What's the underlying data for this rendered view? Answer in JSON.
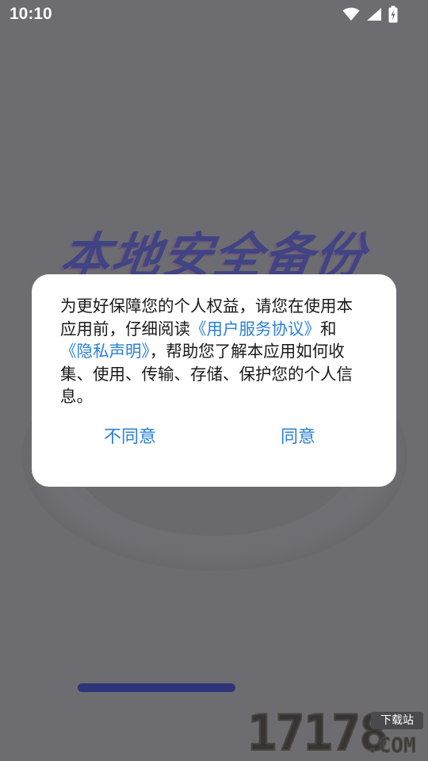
{
  "status_bar": {
    "time": "10:10",
    "icons": [
      "wifi-icon",
      "cellular-signal-icon",
      "battery-charging-icon"
    ]
  },
  "splash": {
    "title": "本地安全备份"
  },
  "dialog": {
    "text_before_link1": "为更好保障您的个人权益，请您在使用本应用前，仔细阅读",
    "link_user_agreement": "《用户服务协议》",
    "text_and": "和",
    "link_privacy_policy": "《隐私声明》",
    "text_after_links": "，帮助您了解本应用如何收集、使用、传输、存储、保护您的个人信息。",
    "disagree_label": "不同意",
    "agree_label": "同意"
  },
  "watermark": {
    "digits": "17178",
    "domain": ".COM",
    "tag": "下载站"
  },
  "colors": {
    "link": "#2a80d5",
    "overlay_background": "#6d6d71",
    "dialog_background": "#ffffff",
    "home_bar": "#2e3478"
  }
}
